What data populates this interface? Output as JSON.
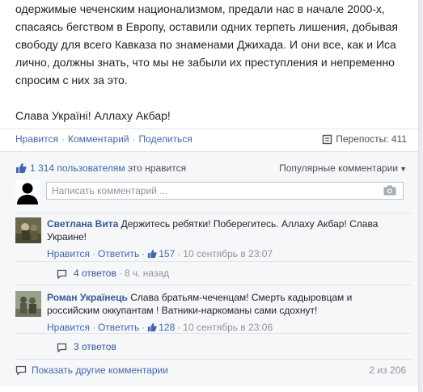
{
  "post": {
    "lines": [
      "одержимые чеченским национализмом, предали нас в начале 2000-х,",
      "спасаясь бегством в Европу, оставили одних терпеть лишения, добывая",
      "свободу для всего Кавказа по знаменами Джихада. И они все, как и Иса",
      "лично, должны знать, что мы не забыли их преступления и непременно",
      "спросим с них за это."
    ],
    "closing": "Слава Україні! Аллаху Акбар!"
  },
  "actions": {
    "like": "Нравится",
    "comment": "Комментарий",
    "share": "Поделиться",
    "separator": "·",
    "reposts": "Перепосты: 411"
  },
  "feedback": {
    "likes_count": "1 314 пользователям",
    "likes_suffix": " это нравится",
    "sort_label": "Популярные комментарии",
    "composer_placeholder": "Написать комментарий ..."
  },
  "comments": [
    {
      "author": "Светлана Вита",
      "text": "Держитесь ребятки! Поберегитесь. Аллаху Акбар! Слава Украине!",
      "like": "Нравится",
      "reply": "Ответить",
      "like_count": "157",
      "time": "10 сентябрь в 23:07",
      "replies": "4 ответов",
      "replies_time": "8 ч. назад"
    },
    {
      "author": "Роман Українець",
      "text": "Слава братьям-чеченцам! Смерть кадыровцам и российским оккупантам ! Ватники-наркоманы сами сдохнут!",
      "like": "Нравится",
      "reply": "Ответить",
      "like_count": "128",
      "time": "10 сентябрь в 23:06",
      "replies": "3 ответов",
      "replies_time": ""
    }
  ],
  "footer": {
    "more_comments": "Показать другие комментарии",
    "counter": "2 из 206"
  },
  "colors": {
    "link": "#4267b2",
    "author": "#365899",
    "muted": "#90949c",
    "feedback_bg": "#f6f7f9"
  }
}
